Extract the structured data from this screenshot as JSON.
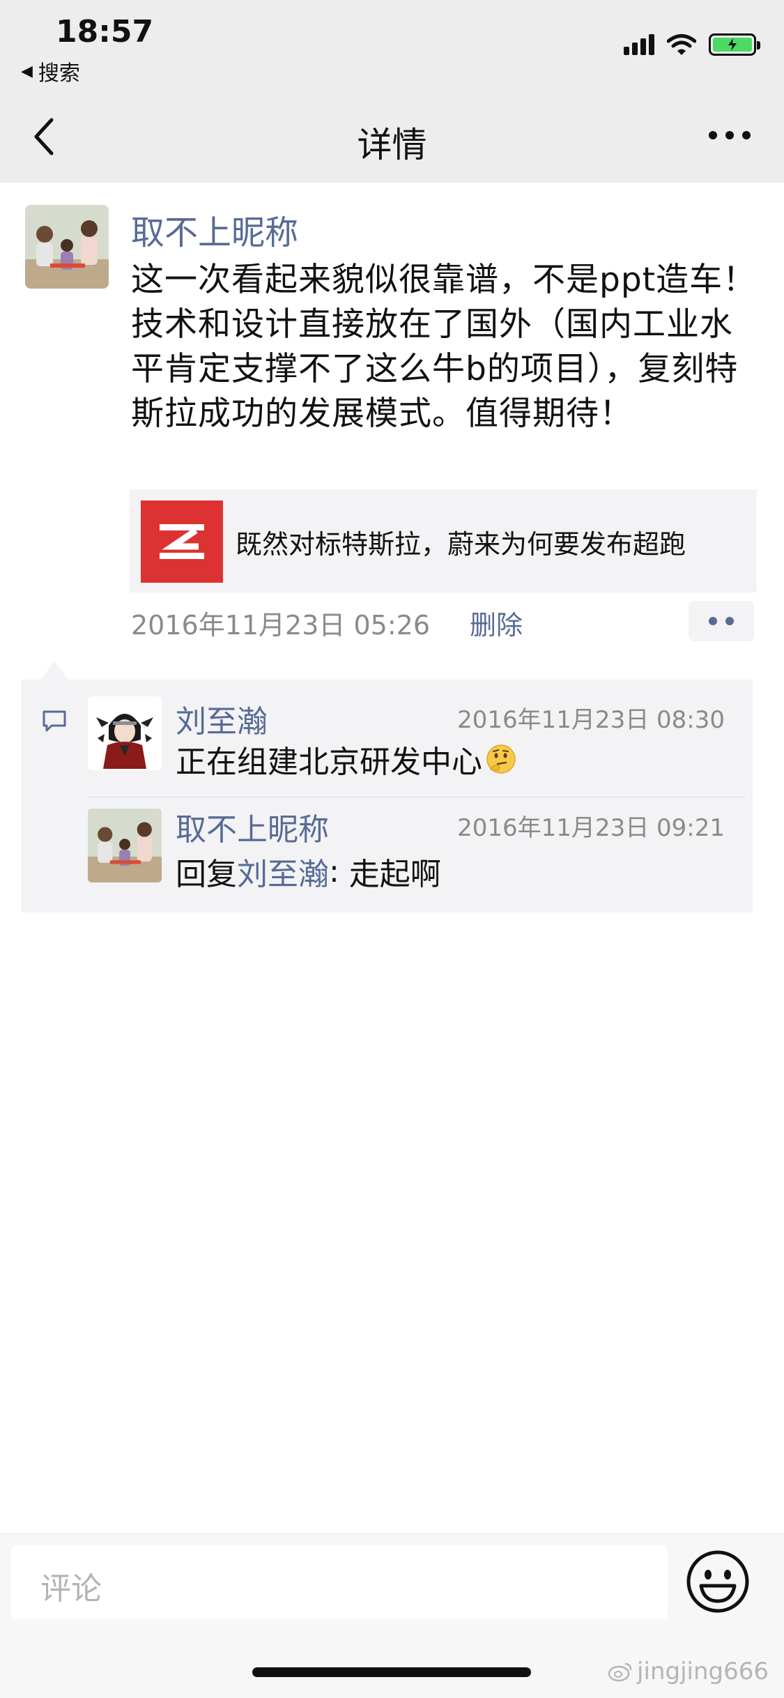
{
  "status_bar": {
    "time": "18:57",
    "back_to_app": "搜索"
  },
  "nav": {
    "title": "详情"
  },
  "post": {
    "author": "取不上昵称",
    "text": "这一次看起来貌似很靠谱，不是ppt造车！技术和设计直接放在了国外（国内工业水平肯定支撑不了这么牛b的项目），复刻特斯拉成功的发展模式。值得期待！",
    "link_title": "既然对标特斯拉，蔚来为何要发布超跑",
    "time": "2016年11月23日 05:26",
    "delete_label": "删除"
  },
  "comments": [
    {
      "author": "刘至瀚",
      "time": "2016年11月23日 08:30",
      "text": "正在组建北京研发中心"
    },
    {
      "author": "取不上昵称",
      "time": "2016年11月23日 09:21",
      "reply_prefix": "回复",
      "reply_to": "刘至瀚",
      "reply_sep": ": ",
      "text": "走起啊"
    }
  ],
  "input": {
    "placeholder": "评论"
  },
  "watermark": "jingjing666",
  "colors": {
    "link": "#576b95",
    "nav_bg": "#ededed",
    "card_bg": "#f3f3f5",
    "thumb": "#dc3232",
    "battery": "#4cd964"
  },
  "icons": [
    "back-chevron-icon",
    "more-icon",
    "signal-icon",
    "wifi-icon",
    "battery-icon",
    "comment-icon",
    "emoji-icon"
  ]
}
